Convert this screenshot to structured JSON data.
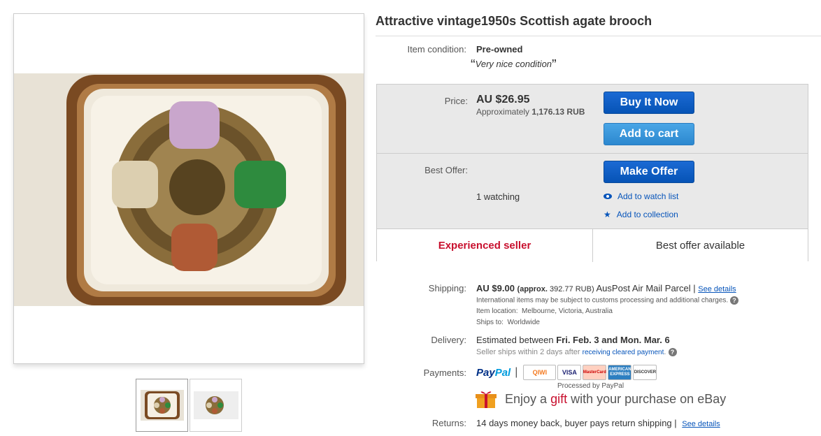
{
  "listing": {
    "title": "Attractive vintage1950s Scottish agate brooch"
  },
  "condition": {
    "label": "Item condition:",
    "value": "Pre-owned",
    "note": "Very nice condition"
  },
  "price": {
    "label": "Price:",
    "value": "AU $26.95",
    "approx_prefix": "Approximately",
    "approx_value": "1,176.13 RUB"
  },
  "buttons": {
    "buy_now": "Buy It Now",
    "add_to_cart": "Add to cart",
    "make_offer": "Make Offer"
  },
  "best_offer": {
    "label": "Best Offer:",
    "watching": "1 watching",
    "watch_link": "Add to watch list",
    "collection_link": "Add to collection"
  },
  "badges": {
    "seller": "Experienced seller",
    "offer": "Best offer available"
  },
  "shipping": {
    "label": "Shipping:",
    "cost": "AU $9.00",
    "approx": "(approx.",
    "approx_value": "392.77 RUB)",
    "service": "AusPost Air Mail Parcel |",
    "see_details": "See details",
    "intl_note": "International items may be subject to customs processing and additional charges.",
    "location_label": "Item location:",
    "location": "Melbourne, Victoria, Australia",
    "ships_to_label": "Ships to:",
    "ships_to": "Worldwide"
  },
  "delivery": {
    "label": "Delivery:",
    "prefix": "Estimated between",
    "dates": "Fri. Feb. 3 and Mon. Mar. 6",
    "note_prefix": "Seller ships within 2 days after",
    "note_link": "receiving cleared payment",
    "note_suffix": "."
  },
  "payments": {
    "label": "Payments:",
    "paypal_a": "Pay",
    "paypal_b": "Pal",
    "cards": [
      "QIWI",
      "VISA",
      "MasterCard",
      "AMERICAN EXPRESS",
      "DISCOVER"
    ],
    "processed": "Processed by PayPal"
  },
  "gift": {
    "prefix": "Enjoy a",
    "word": "gift",
    "suffix": "with your purchase on eBay"
  },
  "returns": {
    "label": "Returns:",
    "text": "14 days money back, buyer pays return shipping |",
    "see_details": "See details"
  },
  "colors": {
    "brand_blue": "#0654ba",
    "seller_red": "#c8102e",
    "price_bg": "#e9e9e9"
  }
}
